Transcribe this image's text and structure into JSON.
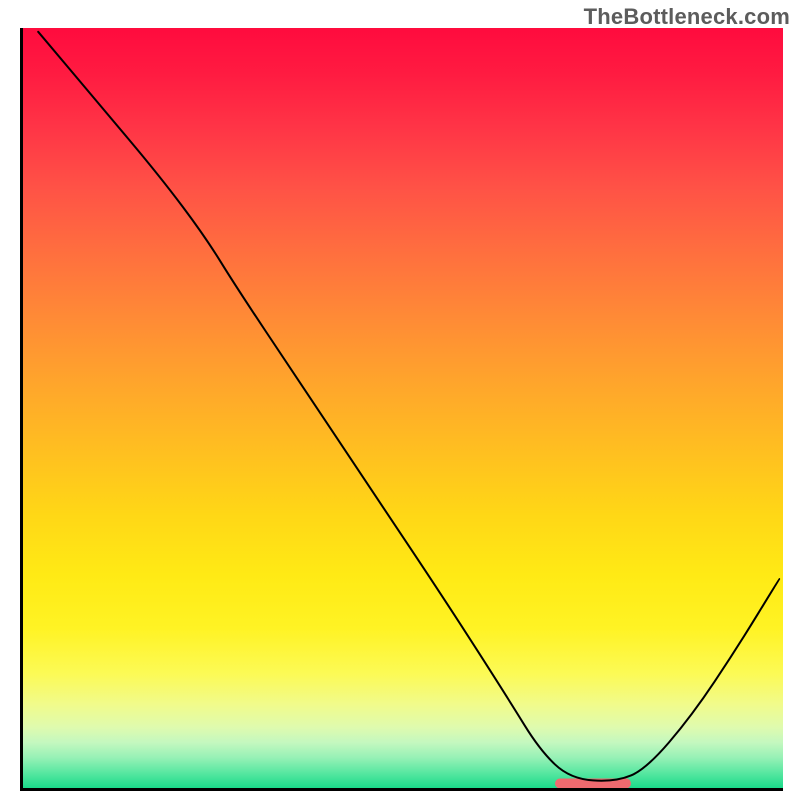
{
  "watermark": "TheBottleneck.com",
  "chart_data": {
    "type": "line",
    "title": "",
    "xlabel": "",
    "ylabel": "",
    "xlim": [
      0,
      100
    ],
    "ylim": [
      0,
      100
    ],
    "grid": false,
    "legend": false,
    "background": {
      "type": "vertical-gradient",
      "stops": [
        {
          "pos": 0.0,
          "color": "#ff0b3e"
        },
        {
          "pos": 0.5,
          "color": "#ffb820"
        },
        {
          "pos": 0.8,
          "color": "#fff324"
        },
        {
          "pos": 1.0,
          "color": "#1bda8a"
        }
      ]
    },
    "notes": "No axis ticks or numeric labels are visible; x/y units unknown. Values below are normalized 0-100 read from pixel positions.",
    "series": [
      {
        "name": "curve",
        "color": "#000000",
        "stroke_width": 2,
        "x": [
          2.0,
          10.0,
          18.0,
          24.0,
          28.0,
          36.0,
          46.0,
          56.0,
          64.0,
          68.0,
          72.0,
          78.0,
          82.0,
          88.0,
          94.0,
          99.5
        ],
        "y": [
          99.5,
          90.0,
          80.5,
          72.5,
          66.0,
          54.0,
          39.0,
          24.0,
          11.5,
          5.0,
          1.2,
          0.8,
          2.5,
          9.5,
          18.5,
          27.5
        ]
      }
    ],
    "markers": [
      {
        "name": "threshold-band",
        "shape": "rounded-bar",
        "color": "#ef6a6f",
        "x_start": 70.0,
        "x_end": 80.0,
        "y": 0.6,
        "height": 1.3
      }
    ]
  }
}
